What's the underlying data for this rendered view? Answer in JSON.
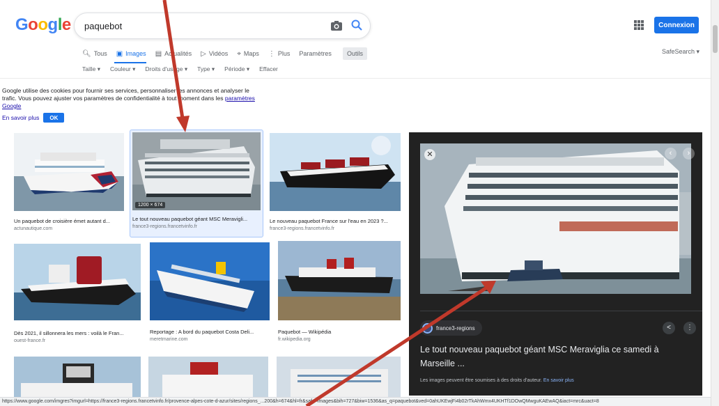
{
  "header": {
    "logo_text": "Google",
    "search_query": "paquebot",
    "signin_label": "Connexion"
  },
  "tabs": [
    {
      "label": "Tous",
      "icon": "search-icon",
      "active": false
    },
    {
      "label": "Images",
      "icon": "image-icon",
      "active": true
    },
    {
      "label": "Actualités",
      "icon": "news-icon",
      "active": false
    },
    {
      "label": "Vidéos",
      "icon": "video-icon",
      "active": false
    },
    {
      "label": "Maps",
      "icon": "map-icon",
      "active": false
    },
    {
      "label": "Plus",
      "icon": "more-icon",
      "active": false
    },
    {
      "label": "Paramètres",
      "icon": "",
      "active": false
    },
    {
      "label": "Outils",
      "icon": "",
      "active": false
    }
  ],
  "safesearch_label": "SafeSearch ▾",
  "filters": [
    "Taille ▾",
    "Couleur ▾",
    "Droits d'usage ▾",
    "Type ▾",
    "Période ▾",
    "Effacer"
  ],
  "cookie": {
    "text": "Google utilise des cookies pour fournir ses services, personnaliser les annonces et analyser le trafic. Vous pouvez ajuster vos paramètres de confidentialité à tout moment dans les",
    "link": "paramètres Google",
    "more": "En savoir plus",
    "ok": "OK"
  },
  "results": [
    {
      "title": "Un paquebot de croisière émet autant d...",
      "source": "actunautique.com"
    },
    {
      "title": "Le tout nouveau paquebot géant MSC Meravigli...",
      "source": "france3-regions.francetvinfo.fr",
      "dims": "1200 × 674"
    },
    {
      "title": "Le nouveau paquebot France sur l'eau en 2023 ?...",
      "source": "france3-regions.francetvinfo.fr"
    },
    {
      "title": "Dès 2021, il sillonnera les mers : voilà le Fran...",
      "source": "ouest-france.fr"
    },
    {
      "title": "Reportage : A bord du paquebot Costa Deli...",
      "source": "meretmarine.com"
    },
    {
      "title": "Paquebot — Wikipédia",
      "source": "fr.wikipedia.org"
    }
  ],
  "preview": {
    "source": "france3-regions",
    "title": "Le tout nouveau paquebot géant MSC Meraviglia ce samedi à Marseille ...",
    "copyright": "Les images peuvent être soumises à des droits d'auteur.",
    "learn_more": "En savoir plus"
  },
  "status_url": "https://www.google.com/imgres?imgurl=https://france3-regions.francetvinfo.fr/provence-alpes-cote-d-azur/sites/regions_...200&h=674&hl=fr&safe=images&bih=727&biw=1536&as_q=paquebot&ved=0ahUKEwjFi4b02rTkAhWmx4UKHTf1DOwQMwguKAEwAQ&iact=mrc&uact=8",
  "colors": {
    "accent": "#1a73e8",
    "annotation_arrow": "#c0392b",
    "panel_bg": "#222222"
  }
}
